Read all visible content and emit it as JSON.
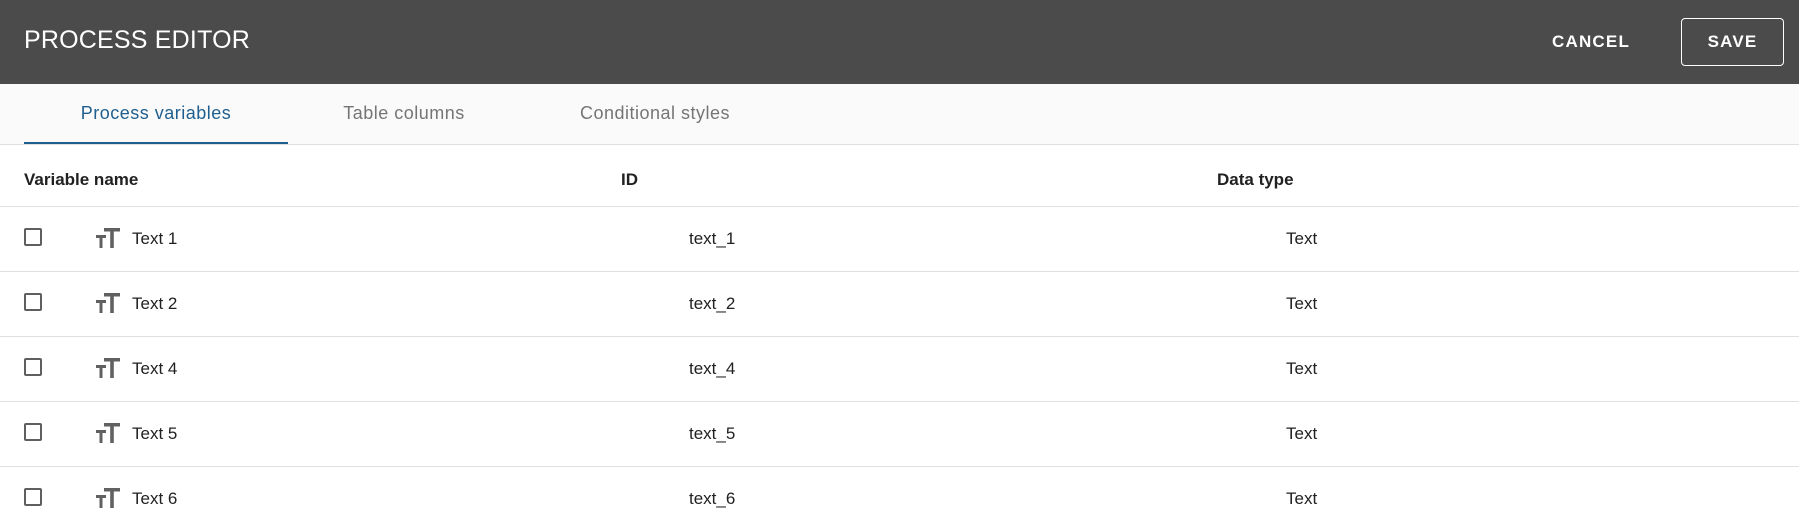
{
  "header": {
    "title": "PROCESS EDITOR",
    "cancel_label": "CANCEL",
    "save_label": "SAVE"
  },
  "tabs": [
    {
      "label": "Process variables",
      "active": true
    },
    {
      "label": "Table columns",
      "active": false
    },
    {
      "label": "Conditional styles",
      "active": false
    }
  ],
  "table": {
    "columns": [
      "Variable name",
      "ID",
      "Data type"
    ],
    "rows": [
      {
        "name": "Text 1",
        "id": "text_1",
        "type": "Text",
        "icon": "text-type-icon",
        "checked": false
      },
      {
        "name": "Text 2",
        "id": "text_2",
        "type": "Text",
        "icon": "text-type-icon",
        "checked": false
      },
      {
        "name": "Text 4",
        "id": "text_4",
        "type": "Text",
        "icon": "text-type-icon",
        "checked": false
      },
      {
        "name": "Text 5",
        "id": "text_5",
        "type": "Text",
        "icon": "text-type-icon",
        "checked": false
      },
      {
        "name": "Text 6",
        "id": "text_6",
        "type": "Text",
        "icon": "text-type-icon",
        "checked": false
      }
    ]
  },
  "colors": {
    "header_bg": "#4b4b4b",
    "active_tab": "#1f5f8f",
    "inactive_tab": "#757575",
    "divider": "#e0e0e0"
  }
}
